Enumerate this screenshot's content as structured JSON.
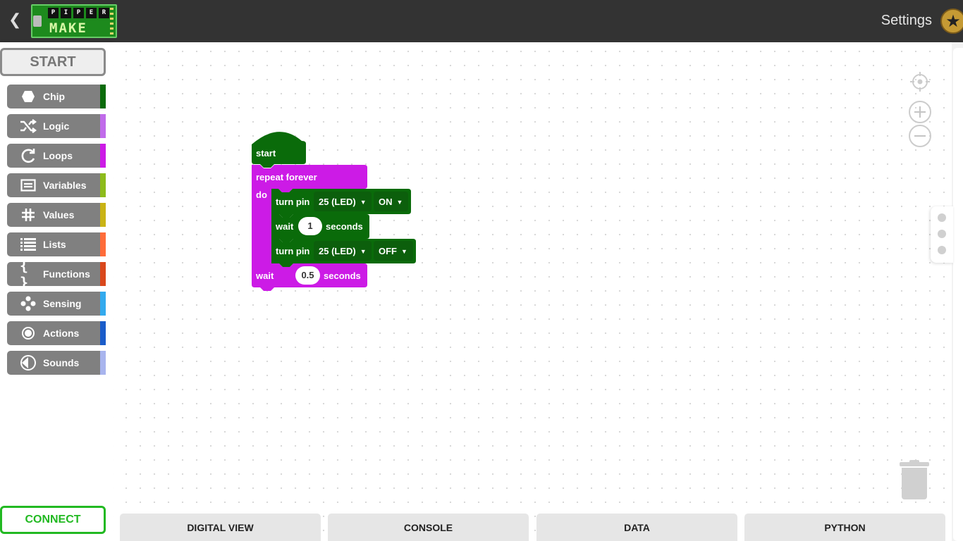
{
  "topbar": {
    "back_glyph": "❮",
    "logo_letters": [
      "P",
      "I",
      "P",
      "E",
      "R"
    ],
    "logo_word": "MAKE",
    "settings_label": "Settings",
    "avatar_icon": "★"
  },
  "sidebar": {
    "start_label": "START",
    "categories": [
      {
        "label": "Chip",
        "icon": "hexagon-icon",
        "color": "#0a6b0a"
      },
      {
        "label": "Logic",
        "icon": "shuffle-icon",
        "color": "#c06bea"
      },
      {
        "label": "Loops",
        "icon": "loop-icon",
        "color": "#cc1be6"
      },
      {
        "label": "Variables",
        "icon": "variable-box-icon",
        "color": "#8dbb1b"
      },
      {
        "label": "Values",
        "icon": "hash-icon",
        "color": "#c9b315"
      },
      {
        "label": "Lists",
        "icon": "list-icon",
        "color": "#ff6c3a"
      },
      {
        "label": "Functions",
        "icon": "braces-icon",
        "color": "#d9481c"
      },
      {
        "label": "Sensing",
        "icon": "sensing-dots-icon",
        "color": "#33aaee"
      },
      {
        "label": "Actions",
        "icon": "record-icon",
        "color": "#1a5cc9"
      },
      {
        "label": "Sounds",
        "icon": "speaker-icon",
        "color": "#a8b4ee"
      }
    ],
    "connect_label": "CONNECT"
  },
  "blocks": {
    "start_label": "start",
    "repeat_label": "repeat forever",
    "do_label": "do",
    "turn_pin_label": "turn pin",
    "pin1_value": "25 (LED)",
    "state1_value": "ON",
    "wait_label": "wait",
    "wait1_value": "1",
    "seconds_label": "seconds",
    "pin2_value": "25 (LED)",
    "state2_value": "OFF",
    "wait2_value": "0.5",
    "colors": {
      "chip": "#0a6b0a",
      "loops": "#cc1be6"
    }
  },
  "tabs": [
    "DIGITAL VIEW",
    "CONSOLE",
    "DATA",
    "PYTHON"
  ]
}
